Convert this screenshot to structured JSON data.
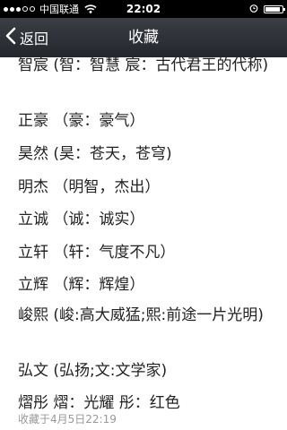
{
  "status_bar": {
    "carrier": "中国联通",
    "time": "22:02",
    "battery_level": 0.9
  },
  "nav": {
    "back_label": "返回",
    "title": "收藏"
  },
  "entries": [
    "智宸 (智：智慧 宸：古代君王的代称)",
    "正豪 （豪：豪气）",
    "昊然 (昊：苍天，苍穹)",
    "明杰 （明智，杰出）",
    "立诚 （诚：诚实）",
    "立轩 （轩：气度不凡）",
    "立辉 （辉：辉煌）",
    "峻熙 (峻:高大威猛;熙:前途一片光明)",
    "弘文 (弘扬;文:文学家)",
    "熠彤 熠：光耀 彤：红色"
  ],
  "footer": {
    "saved_at": "收藏于4月5日22:19"
  },
  "icons": {
    "back": "chevron-left-icon",
    "wifi": "wifi-icon",
    "alarm": "alarm-clock-icon",
    "battery": "battery-icon"
  }
}
